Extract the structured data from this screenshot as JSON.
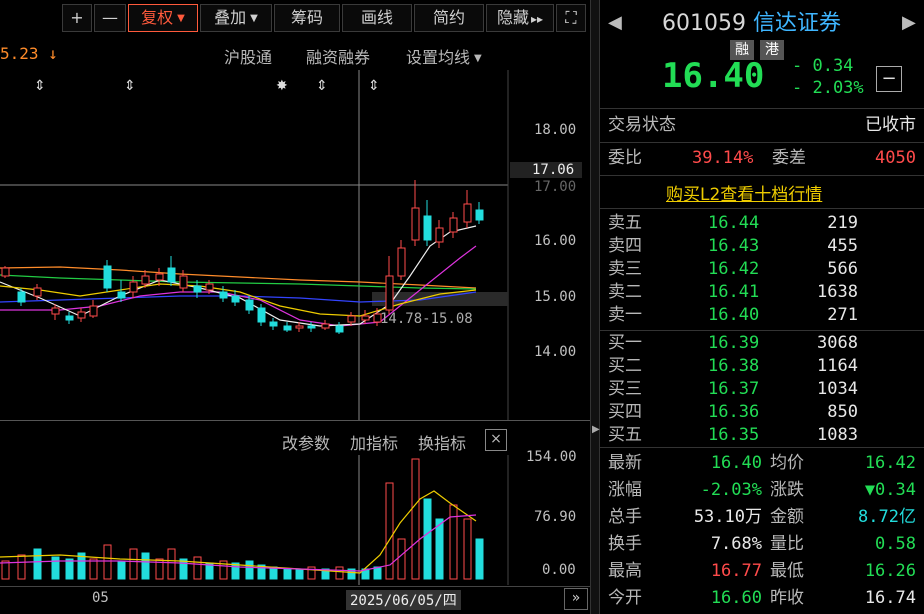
{
  "toolbar": {
    "plus": "+",
    "minus": "—",
    "fuquan": "复权",
    "diejia": "叠加",
    "chouma": "筹码",
    "huaxian": "画线",
    "jianyue": "简约",
    "yincang": "隐藏",
    "yincang_arrow": "▸▸",
    "fullscreen": "⛶"
  },
  "chart_header": {
    "left_value": "5.23",
    "left_arrow": "↓",
    "hugutong": "沪股通",
    "rongzirongquan": "融资融券",
    "shezhi_junxian": "设置均线"
  },
  "price_axis": {
    "ticks": [
      "18.00",
      "17.00",
      "16.00",
      "15.00",
      "14.00"
    ],
    "crosshair_value": "17.06",
    "range_label": "14.78-15.08"
  },
  "volume_toolbar": {
    "gaicanshu": "改参数",
    "jiazhibiao": "加指标",
    "huanzhibiao": "换指标",
    "close": "×"
  },
  "volume_axis": {
    "ticks": [
      "154.00",
      "76.90",
      "0.00"
    ]
  },
  "date_axis": {
    "tick": "05",
    "cursor_date": "2025/06/05/四",
    "more": "»"
  },
  "header": {
    "code": "601059",
    "name": "信达证券",
    "badge_rong": "融",
    "badge_gang": "港",
    "price": "16.40",
    "change": "- 0.34",
    "change_pct": "- 2.03%",
    "prev_arrow": "◀",
    "next_arrow": "▶",
    "collapse": "−"
  },
  "trade_status": {
    "label": "交易状态",
    "value": "已收市"
  },
  "weibi": {
    "label": "委比",
    "value": "39.14%",
    "cha_label": "委差",
    "cha_value": "4050"
  },
  "l2_link": "购买L2查看十档行情",
  "asks": [
    {
      "label": "卖五",
      "price": "16.44",
      "vol": "219"
    },
    {
      "label": "卖四",
      "price": "16.43",
      "vol": "455"
    },
    {
      "label": "卖三",
      "price": "16.42",
      "vol": "566"
    },
    {
      "label": "卖二",
      "price": "16.41",
      "vol": "1638"
    },
    {
      "label": "卖一",
      "price": "16.40",
      "vol": "271"
    }
  ],
  "bids": [
    {
      "label": "买一",
      "price": "16.39",
      "vol": "3068"
    },
    {
      "label": "买二",
      "price": "16.38",
      "vol": "1164"
    },
    {
      "label": "买三",
      "price": "16.37",
      "vol": "1034"
    },
    {
      "label": "买四",
      "price": "16.36",
      "vol": "850"
    },
    {
      "label": "买五",
      "price": "16.35",
      "vol": "1083"
    }
  ],
  "stats": [
    {
      "l1": "最新",
      "v1": "16.40",
      "c1": "green",
      "l2": "均价",
      "v2": "16.42",
      "c2": "green"
    },
    {
      "l1": "涨幅",
      "v1": "-2.03%",
      "c1": "green",
      "l2": "涨跌",
      "v2": "▼0.34",
      "c2": "green"
    },
    {
      "l1": "总手",
      "v1": "53.10万",
      "c1": "white",
      "l2": "金额",
      "v2": "8.72亿",
      "c2": "cyan"
    },
    {
      "l1": "换手",
      "v1": "7.68%",
      "c1": "white",
      "l2": "量比",
      "v2": "0.58",
      "c2": "green"
    },
    {
      "l1": "最高",
      "v1": "16.77",
      "c1": "red",
      "l2": "最低",
      "v2": "16.26",
      "c2": "green"
    },
    {
      "l1": "今开",
      "v1": "16.60",
      "c1": "green",
      "l2": "昨收",
      "v2": "16.74",
      "c2": "white"
    }
  ],
  "colors": {
    "up": "#ff4b4b",
    "down": "#22dddd",
    "green": "#22dd55",
    "cyan": "#22dddd"
  }
}
